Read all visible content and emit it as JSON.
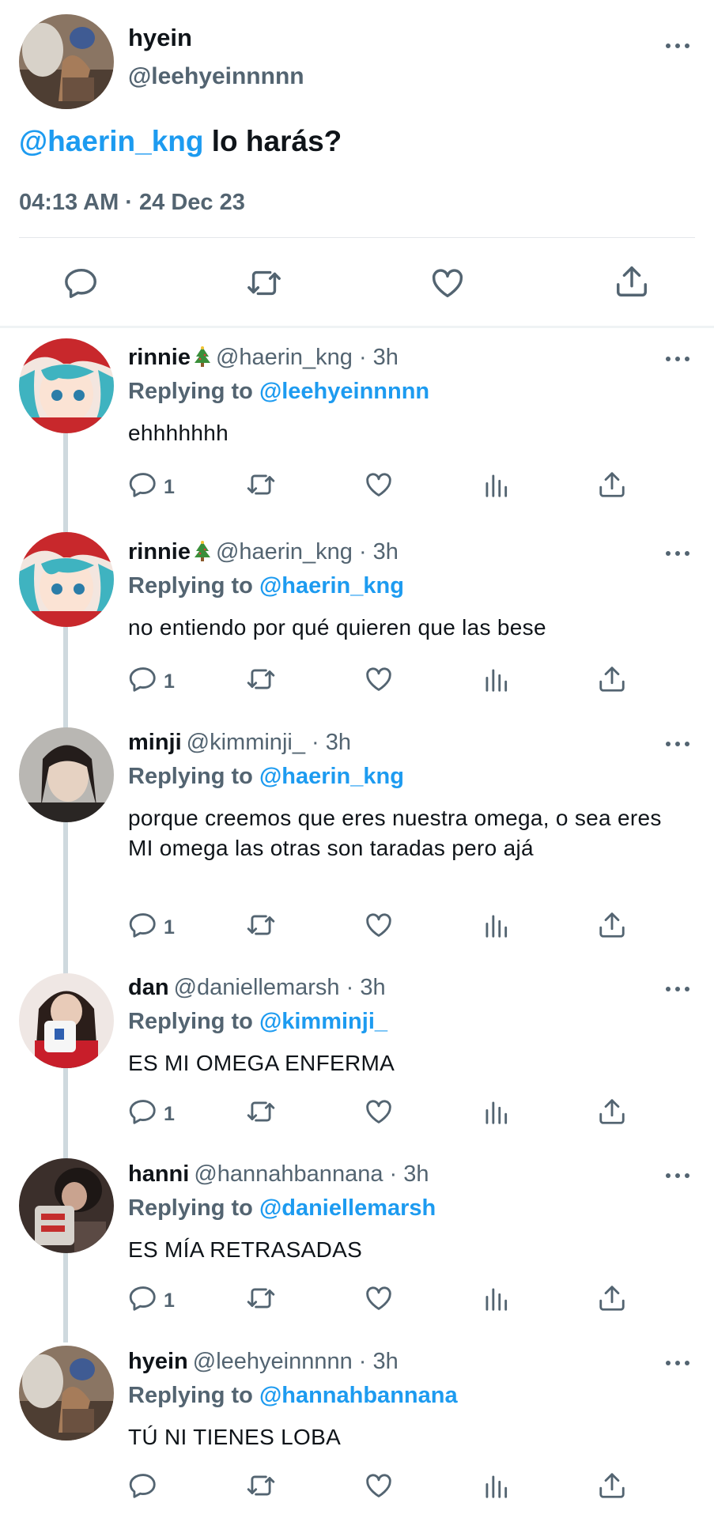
{
  "main_tweet": {
    "name": "hyein",
    "handle": "@leehyeinnnnn",
    "mention": "@haerin_kng",
    "text": " lo harás?",
    "timestamp": "04:13 AM · 24 Dec 23",
    "actions": [
      "reply-icon",
      "retweet-icon",
      "like-icon",
      "share-icon"
    ]
  },
  "replies": [
    {
      "name": "rinnie",
      "emoji": "🎄",
      "meta": "@haerin_kng · 3h",
      "replying_label": "Replying to",
      "replying_to": "@leehyeinnnnn",
      "text": "ehhhhhhh",
      "reply_count": "1"
    },
    {
      "name": "rinnie",
      "emoji": "🎄",
      "meta": "@haerin_kng · 3h",
      "replying_label": "Replying to",
      "replying_to": "@haerin_kng",
      "text": "no entiendo por qué quieren que las bese",
      "reply_count": "1"
    },
    {
      "name": "minji",
      "meta": "@kimminji_ · 3h",
      "replying_label": "Replying to",
      "replying_to": "@haerin_kng",
      "text": "porque creemos que eres nuestra omega, o sea eres MI omega las otras son taradas pero ajá",
      "reply_count": "1"
    },
    {
      "name": "dan",
      "meta": "@daniellemarsh · 3h",
      "replying_label": "Replying to",
      "replying_to": "@kimminji_",
      "text": "ES MI OMEGA ENFERMA",
      "reply_count": "1"
    },
    {
      "name": "hanni",
      "meta": "@hannahbannana · 3h",
      "replying_label": "Replying to",
      "replying_to": "@daniellemarsh",
      "text": "ES MÍA RETRASADAS",
      "reply_count": "1"
    },
    {
      "name": "hyein",
      "meta": "@leehyeinnnnn · 3h",
      "replying_label": "Replying to",
      "replying_to": "@hannahbannana",
      "text": "TÚ NI TIENES LOBA",
      "reply_count": ""
    }
  ],
  "colors": {
    "accent": "#1d9bf0",
    "secondary_text": "#536471",
    "thread_line": "#cfd9de"
  }
}
